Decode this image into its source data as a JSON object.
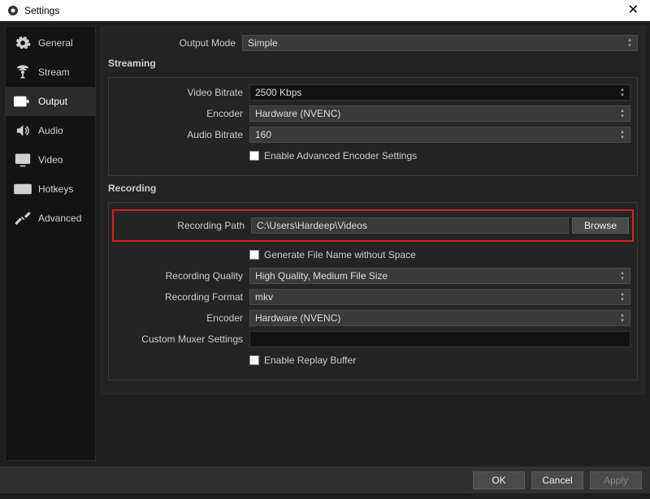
{
  "window": {
    "title": "Settings"
  },
  "sidebar": {
    "items": [
      {
        "label": "General"
      },
      {
        "label": "Stream"
      },
      {
        "label": "Output"
      },
      {
        "label": "Audio"
      },
      {
        "label": "Video"
      },
      {
        "label": "Hotkeys"
      },
      {
        "label": "Advanced"
      }
    ],
    "active_index": 2
  },
  "output": {
    "mode_label": "Output Mode",
    "mode_value": "Simple",
    "streaming": {
      "title": "Streaming",
      "video_bitrate_label": "Video Bitrate",
      "video_bitrate_value": "2500 Kbps",
      "encoder_label": "Encoder",
      "encoder_value": "Hardware (NVENC)",
      "audio_bitrate_label": "Audio Bitrate",
      "audio_bitrate_value": "160",
      "adv_checkbox_label": "Enable Advanced Encoder Settings"
    },
    "recording": {
      "title": "Recording",
      "path_label": "Recording Path",
      "path_value": "C:\\Users\\Hardeep\\Videos",
      "browse_label": "Browse",
      "no_space_label": "Generate File Name without Space",
      "quality_label": "Recording Quality",
      "quality_value": "High Quality, Medium File Size",
      "format_label": "Recording Format",
      "format_value": "mkv",
      "encoder_label": "Encoder",
      "encoder_value": "Hardware (NVENC)",
      "muxer_label": "Custom Muxer Settings",
      "muxer_value": "",
      "replay_buffer_label": "Enable Replay Buffer"
    }
  },
  "footer": {
    "ok": "OK",
    "cancel": "Cancel",
    "apply": "Apply"
  }
}
